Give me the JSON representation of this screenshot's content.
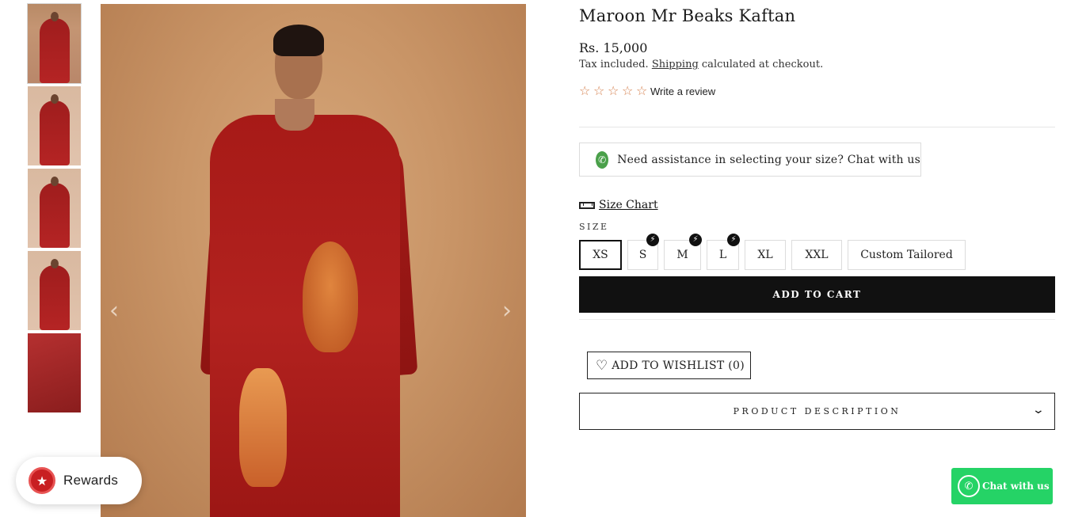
{
  "product": {
    "title": "Maroon Mr Beaks Kaftan",
    "price": "Rs. 15,000",
    "tax_prefix": "Tax included.",
    "tax_link": "Shipping",
    "tax_suffix": "calculated at checkout.",
    "rating_stars": 0,
    "rating_max": 5,
    "write_review": "Write a review"
  },
  "assistance": {
    "text": "Need assistance in selecting your size? Chat with us",
    "icon": "whatsapp-icon"
  },
  "size_chart": {
    "label": "Size Chart",
    "icon": "ruler-icon"
  },
  "sizes": {
    "label": "SIZE",
    "selected": "XS",
    "options": [
      {
        "label": "XS",
        "express": false
      },
      {
        "label": "S",
        "express": true
      },
      {
        "label": "M",
        "express": true
      },
      {
        "label": "L",
        "express": true
      },
      {
        "label": "XL",
        "express": false
      },
      {
        "label": "XXL",
        "express": false
      },
      {
        "label": "Custom Tailored",
        "express": false
      }
    ]
  },
  "actions": {
    "add_to_cart": "ADD TO CART",
    "wishlist": "ADD TO WISHLIST",
    "wishlist_count": "(0)",
    "description": "PRODUCT DESCRIPTION"
  },
  "gallery": {
    "thumbnail_count": 5,
    "prev_icon": "chevron-left-icon",
    "next_icon": "chevron-right-icon"
  },
  "widgets": {
    "rewards": "Rewards",
    "chat": "Chat with us"
  },
  "colors": {
    "accent_button": "#111111",
    "star": "#d5804e",
    "whatsapp": "#25d366",
    "rewards_icon": "#c81f22"
  }
}
